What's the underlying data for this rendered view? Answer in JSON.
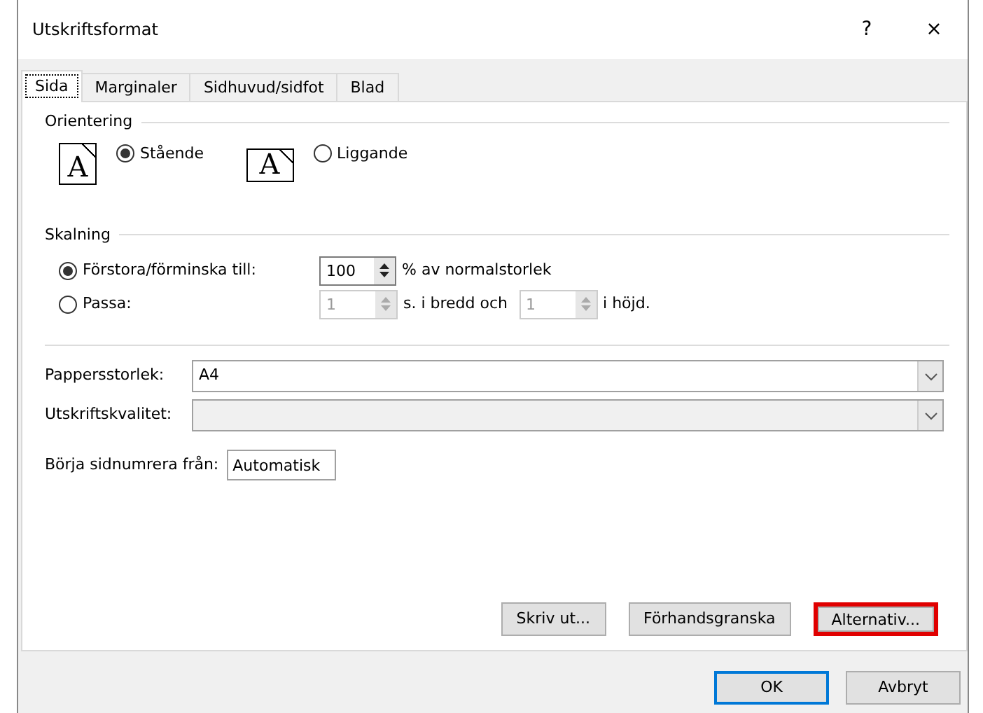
{
  "window": {
    "title": "Utskriftsformat",
    "help": "?",
    "close": "×"
  },
  "tabs": [
    {
      "label": "Sida",
      "selected": true
    },
    {
      "label": "Marginaler",
      "selected": false
    },
    {
      "label": "Sidhuvud/sidfot",
      "selected": false
    },
    {
      "label": "Blad",
      "selected": false
    }
  ],
  "orientation": {
    "title": "Orientering",
    "options": [
      {
        "label": "Stående",
        "selected": true,
        "kind": "portrait",
        "glyph": "A"
      },
      {
        "label": "Liggande",
        "selected": false,
        "kind": "landscape",
        "glyph": "A"
      }
    ]
  },
  "scaling": {
    "title": "Skalning",
    "adjust": {
      "label": "Förstora/förminska till:",
      "selected": true,
      "value": "100",
      "suffix": "% av normalstorlek"
    },
    "fit": {
      "label": "Passa:",
      "selected": false,
      "wide_value": "1",
      "wide_suffix": "s. i bredd och",
      "tall_value": "1",
      "tall_suffix": "i höjd.",
      "disabled": true
    }
  },
  "paper_size": {
    "label": "Pappersstorlek:",
    "value": "A4",
    "disabled": false
  },
  "print_quality": {
    "label": "Utskriftskvalitet:",
    "disabled": true
  },
  "first_page": {
    "label": "Börja sidnumrera från:",
    "value": "Automatisk"
  },
  "panel_buttons": [
    {
      "label": "Skriv ut...",
      "highlighted": false
    },
    {
      "label": "Förhandsgranska",
      "highlighted": false
    },
    {
      "label": "Alternativ...",
      "highlighted": true
    }
  ],
  "buttons": [
    {
      "label": "OK",
      "default": true
    },
    {
      "label": "Avbryt",
      "default": false
    }
  ]
}
